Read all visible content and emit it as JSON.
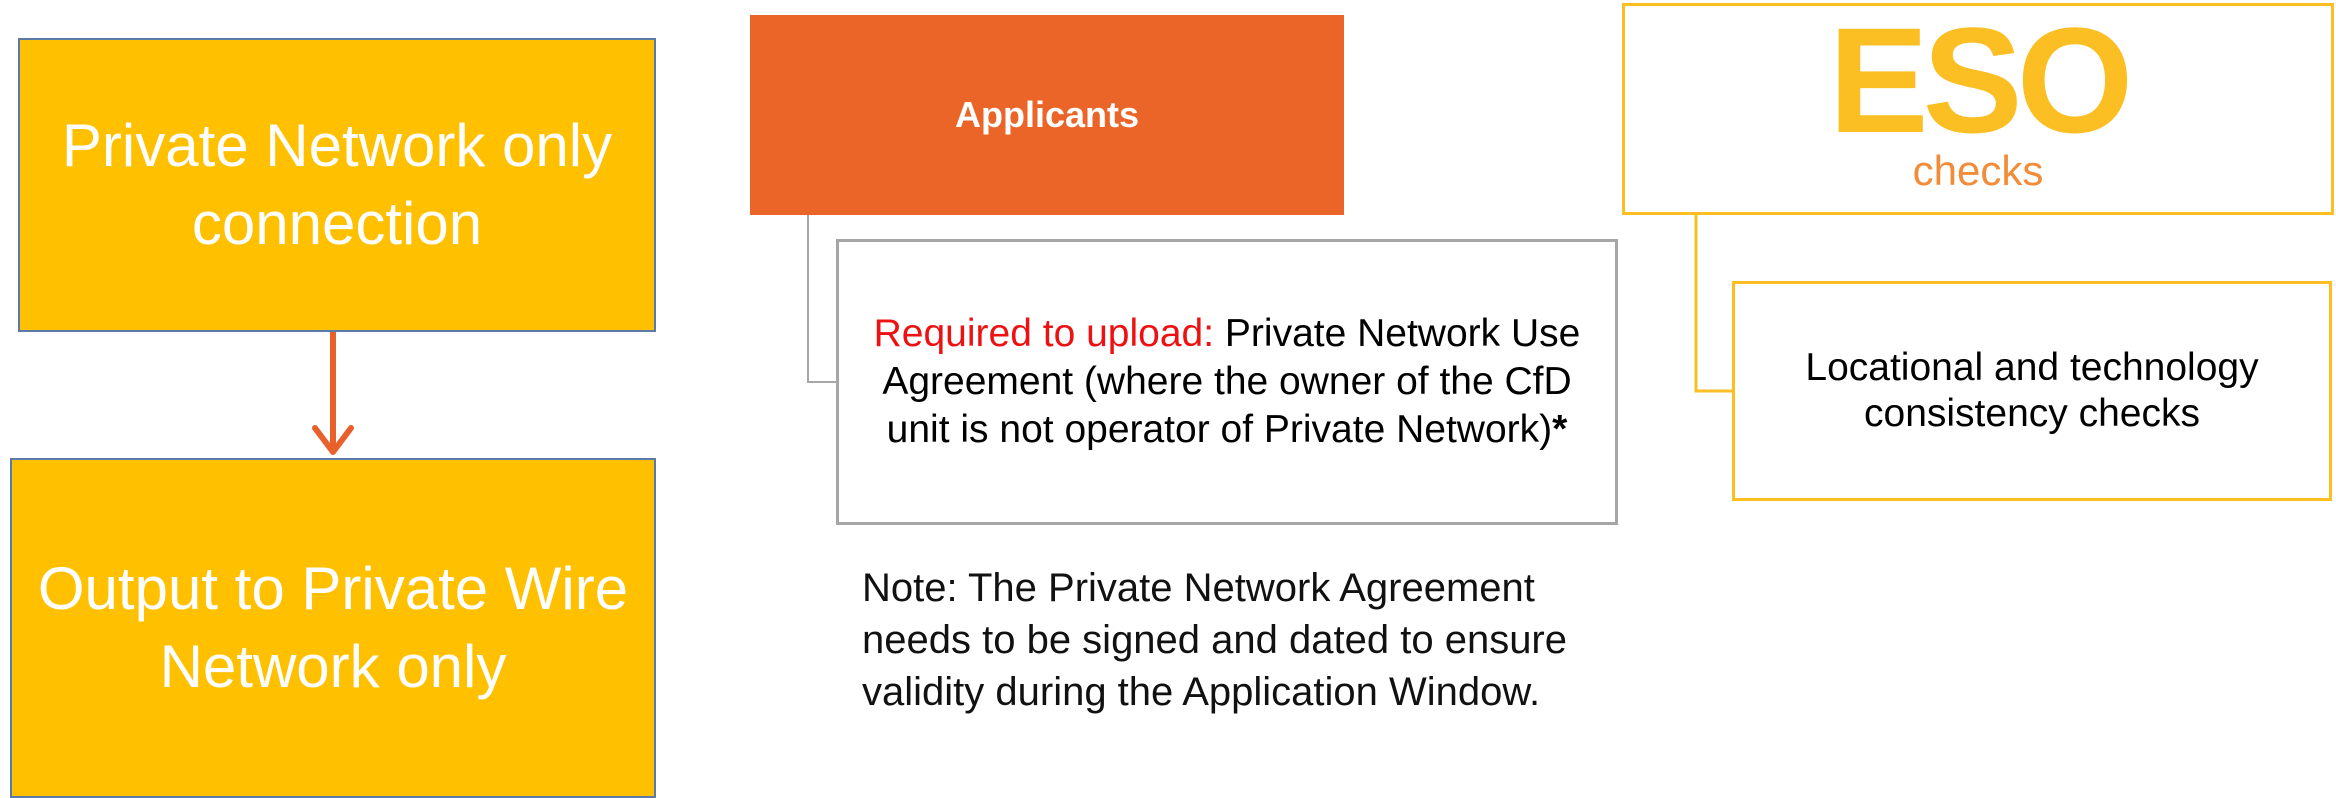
{
  "left_flow": {
    "top_box": "Private Network only connection",
    "bottom_box": "Output to Private Wire Network only"
  },
  "applicants": {
    "header": "Applicants",
    "requirement_prefix": "Required to upload:",
    "requirement_text": " Private Network Use Agreement (where the owner of the CfD unit is not operator of Private Network)",
    "requirement_suffix": "*",
    "note_label": "Note:",
    "note_text": " The Private Network Agreement needs to be signed and dated to ensure validity during the Application Window."
  },
  "eso": {
    "title": "ESO",
    "subtitle": "checks",
    "check_text": "Locational and technology consistency checks"
  },
  "colors": {
    "yellow_box": "#ffc000",
    "orange_header": "#eb6428",
    "arrow": "#e8602c",
    "eso_gold": "#fbbf24",
    "eso_sub_orange": "#f28c38",
    "required_red": "#ee1111",
    "gray_border": "#a6a6a6"
  }
}
